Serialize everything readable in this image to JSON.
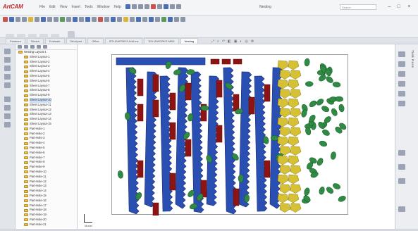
{
  "app": {
    "logo_text": "ArtCAM",
    "menus": [
      "File",
      "Edit",
      "View",
      "Insert",
      "Tools",
      "Window",
      "Help"
    ],
    "document_title": "Nesting",
    "help_search_placeholder": "Search"
  },
  "tabs": [
    "Features",
    "Sketch",
    "Evaluate",
    "DimXpert",
    "Office",
    "SOLIDWORKS Add-Ins",
    "SOLIDWORKS MBD",
    "Nesting"
  ],
  "active_tab_index": 7,
  "tree": {
    "items": [
      "Nesting Layout-1",
      "Sheet Layout-1",
      "Sheet Layout-2",
      "Sheet Layout-3",
      "Sheet Layout-4",
      "Sheet Layout-5",
      "Sheet Layout-6",
      "Sheet Layout-7",
      "Sheet Layout-8",
      "Sheet Layout-9",
      "Sheet Layout-10",
      "Sheet Layout-11",
      "Sheet Layout-12",
      "Sheet Layout-13",
      "Sheet Layout-14",
      "Sheet Layout-15",
      "Part-Hole-1",
      "Part-Hole-2",
      "Part-Hole-3",
      "Part-Hole-4",
      "Part-Hole-5",
      "Part-Hole-6",
      "Part-Hole-7",
      "Part-Hole-8",
      "Part-Hole-9",
      "Part-Hole-10",
      "Part-Hole-11",
      "Part-Hole-12",
      "Part-Hole-13",
      "Part-Hole-14",
      "Part-Hole-15",
      "Part-Hole-16",
      "Part-Hole-17",
      "Part-Hole-18",
      "Part-Hole-19",
      "Part-Hole-20",
      "Part-Hole-21"
    ],
    "selected_index": 10
  },
  "canvas": {
    "label": "Model",
    "part_colors": {
      "blue": "#2a4fb3",
      "dark_red": "#8e1414",
      "green": "#2f8a43",
      "yellow": "#d6c034",
      "outline": "#1c2a6b"
    }
  },
  "right_pane": {
    "label": "Task Pane"
  },
  "colors": {
    "accent": "#4a6fb5",
    "logo": "#c1272d",
    "sheet_border": "#9aa0a8"
  }
}
